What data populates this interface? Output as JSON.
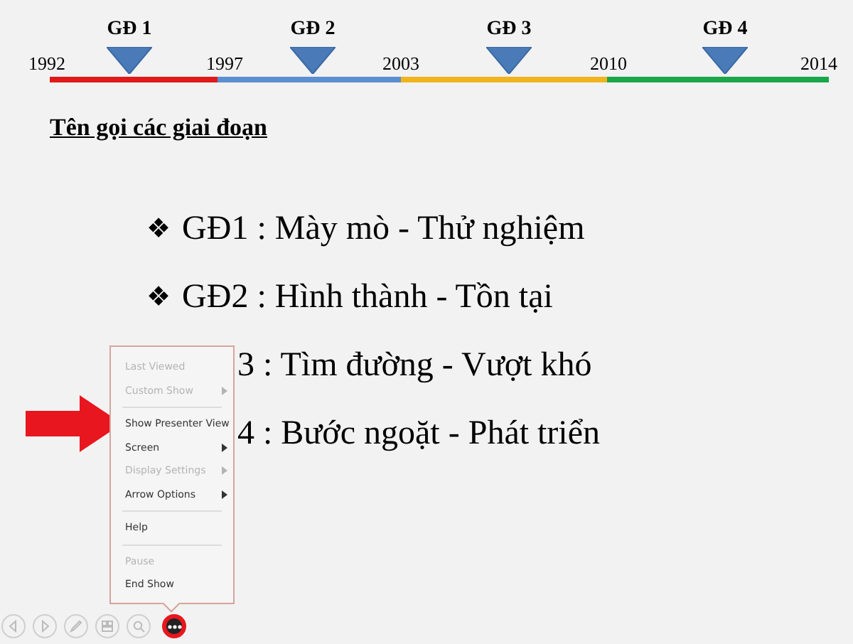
{
  "timeline": {
    "phases": [
      {
        "label": "GĐ 1"
      },
      {
        "label": "GĐ 2"
      },
      {
        "label": "GĐ 3"
      },
      {
        "label": "GĐ 4"
      }
    ],
    "years": [
      "1992",
      "1997",
      "2003",
      "2010",
      "2014"
    ],
    "segments": [
      {
        "color": "#e01a1a"
      },
      {
        "color": "#5b8fd0"
      },
      {
        "color": "#f0b41e"
      },
      {
        "color": "#1aa64a"
      }
    ]
  },
  "heading": "Tên gọi các giai đoạn",
  "bullets": [
    {
      "symbol": "❖",
      "text": "GĐ1 : Mày mò - Thử nghiệm",
      "covered": false
    },
    {
      "symbol": "❖",
      "text": "GĐ2 : Hình thành - Tồn tại",
      "covered": false
    },
    {
      "text": "3 : Tìm đường - Vượt khó",
      "covered": true
    },
    {
      "text": "4 : Bước ngoặt - Phát triển",
      "covered": true
    }
  ],
  "menu": [
    {
      "kind": "item",
      "label": "Last Viewed",
      "disabled": true,
      "submenu": false
    },
    {
      "kind": "item",
      "label": "Custom Show",
      "disabled": true,
      "submenu": true
    },
    {
      "kind": "separator"
    },
    {
      "kind": "item",
      "label": "Show Presenter View",
      "disabled": false,
      "submenu": false
    },
    {
      "kind": "item",
      "label": "Screen",
      "disabled": false,
      "submenu": true
    },
    {
      "kind": "item",
      "label": "Display Settings",
      "disabled": true,
      "submenu": true
    },
    {
      "kind": "item",
      "label": "Arrow Options",
      "disabled": false,
      "submenu": true
    },
    {
      "kind": "separator"
    },
    {
      "kind": "item",
      "label": "Help",
      "disabled": false,
      "submenu": false
    },
    {
      "kind": "separator"
    },
    {
      "kind": "item",
      "label": "Pause",
      "disabled": true,
      "submenu": false
    },
    {
      "kind": "item",
      "label": "End Show",
      "disabled": false,
      "submenu": false
    }
  ],
  "toolbar": [
    {
      "kind": "previous",
      "highlighted": false
    },
    {
      "kind": "next",
      "highlighted": false
    },
    {
      "kind": "pen",
      "highlighted": false
    },
    {
      "kind": "slides",
      "highlighted": false
    },
    {
      "kind": "zoom",
      "highlighted": false
    },
    {
      "kind": "more",
      "highlighted": true
    }
  ]
}
